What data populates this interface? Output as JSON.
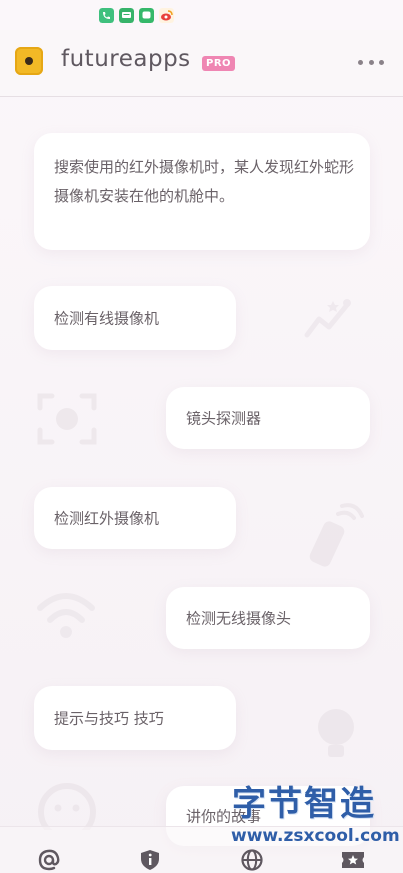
{
  "status_bar": {
    "icons": [
      {
        "name": "phone-icon",
        "color": "#3fc07e"
      },
      {
        "name": "message-icon",
        "color": "#37b36a"
      },
      {
        "name": "chat-icon",
        "color": "#35b86a"
      },
      {
        "name": "weibo-icon",
        "color": "#f0a020"
      }
    ]
  },
  "header": {
    "app_title": "futureapps",
    "badge": "PRO",
    "logo_icon": "camera-logo-icon",
    "more_icon": "more-dots-icon"
  },
  "intro": {
    "text": "搜索使用的红外摄像机时，某人发现红外蛇形摄像机安装在他的机舱中。"
  },
  "cards": [
    {
      "label": "检测有线摄像机"
    },
    {
      "label": "镜头探测器"
    },
    {
      "label": "检测红外摄像机"
    },
    {
      "label": "检测无线摄像头"
    },
    {
      "label": "提示与技巧 技巧"
    },
    {
      "label": "讲你的故事"
    }
  ],
  "watermark": {
    "title": "字节智造",
    "url": "www.zsxcool.com"
  },
  "bottom_nav": {
    "items": [
      {
        "name": "at-icon"
      },
      {
        "name": "info-shield-icon"
      },
      {
        "name": "globe-icon"
      },
      {
        "name": "star-ticket-icon"
      }
    ]
  },
  "colors": {
    "accent_pink": "#ef86b3",
    "logo_yellow": "#f2b926",
    "text": "#6a6268",
    "watermark_blue": "#2f5ea8"
  }
}
